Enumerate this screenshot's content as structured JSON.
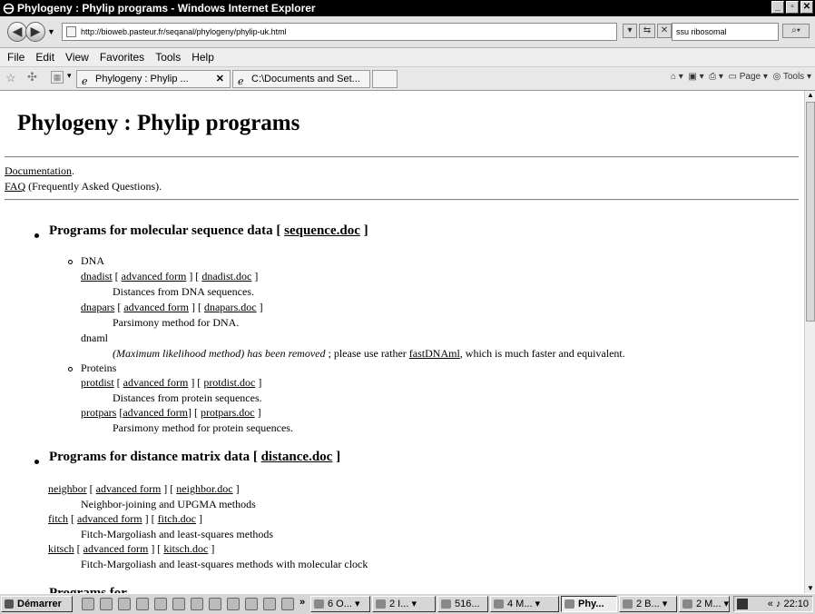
{
  "window": {
    "title": "Phylogeny : Phylip programs - Windows Internet Explorer"
  },
  "nav": {
    "url": "http://bioweb.pasteur.fr/seqanal/phylogeny/phylip-uk.html",
    "search_value": "ssu ribosomal"
  },
  "menu": [
    "File",
    "Edit",
    "View",
    "Favorites",
    "Tools",
    "Help"
  ],
  "tabs": [
    {
      "label": "Phylogeny : Phylip ...",
      "close": "✕"
    },
    {
      "label": "C:\\Documents and Set..."
    }
  ],
  "toolbar": {
    "page": "Page",
    "tools": "Tools"
  },
  "page": {
    "title": "Phylogeny : Phylip programs",
    "doc_link": "Documentation",
    "doc_suffix": ".",
    "faq_link": "FAQ",
    "faq_suffix": " (Frequently Asked Questions).",
    "sections": [
      {
        "heading": "Programs for molecular sequence data [ ",
        "doc": "sequence.doc",
        "close": " ]"
      },
      {
        "heading": "Programs for distance matrix data [ ",
        "doc": "distance.doc",
        "close": " ]"
      },
      {
        "heading": "Programs for ..."
      }
    ],
    "dna": {
      "label": "DNA",
      "dnadist": {
        "name": "dnadist",
        "adv": "advanced form",
        "doc": "dnadist.doc",
        "desc": "Distances from DNA sequences."
      },
      "dnapars": {
        "name": "dnapars",
        "adv": "advanced form",
        "doc": "dnapars.doc",
        "desc": "Parsimony method for DNA."
      },
      "dnaml": {
        "name": "dnaml",
        "removed": "(Maximum likelihood method) has been removed",
        "rest_pre": " ; please use rather ",
        "link": "fastDNAml",
        "rest_post": ", which is much faster and equivalent."
      }
    },
    "proteins": {
      "label": "Proteins",
      "protdist": {
        "name": "protdist",
        "adv": "advanced form",
        "doc": "protdist.doc",
        "desc": "Distances from protein sequences."
      },
      "protpars": {
        "name": "protpars",
        "adv": "advanced form",
        "doc": "protpars.doc",
        "desc": "Parsimony method for protein sequences."
      }
    },
    "distance": {
      "neighbor": {
        "name": "neighbor",
        "adv": "advanced form",
        "doc": "neighbor.doc",
        "desc": "Neighbor-joining and UPGMA methods"
      },
      "fitch": {
        "name": "fitch",
        "adv": "advanced form",
        "doc": "fitch.doc",
        "desc": "Fitch-Margoliash and least-squares methods"
      },
      "kitsch": {
        "name": "kitsch",
        "adv": "advanced form",
        "doc": "kitsch.doc",
        "desc": "Fitch-Margoliash and least-squares methods with molecular clock"
      }
    }
  },
  "taskbar": {
    "start": "Démarrer",
    "more": "»",
    "buttons": [
      "6 O... ▾",
      "2 I... ▾",
      "516...",
      "4 M... ▾",
      "Phy...",
      "2 B... ▾",
      "2 M... ▾"
    ],
    "tray_glyphs": "« ♪",
    "clock": "22:10"
  }
}
